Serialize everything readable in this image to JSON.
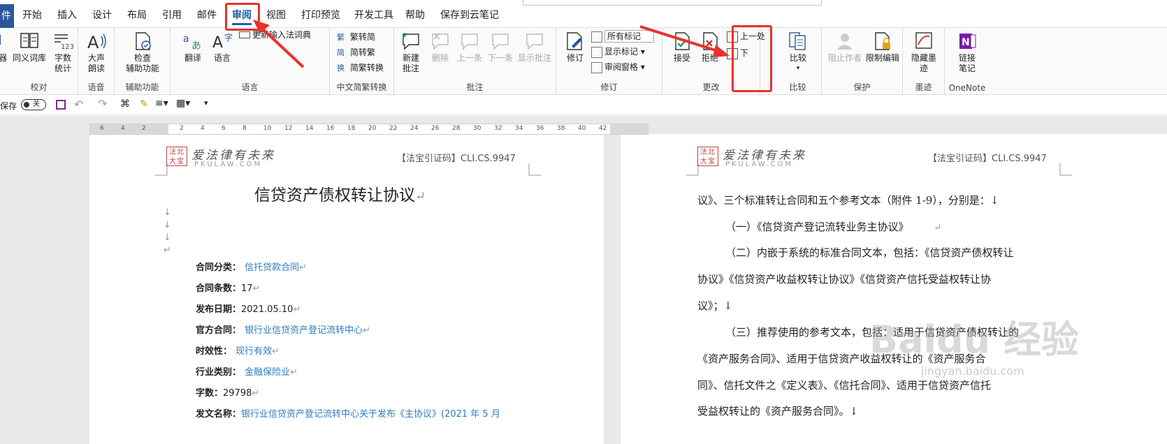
{
  "tabs": {
    "file": "件",
    "items": [
      "开始",
      "插入",
      "设计",
      "布局",
      "引用",
      "邮件",
      "审阅",
      "视图",
      "打印预览",
      "开发工具",
      "帮助",
      "保存到云笔记"
    ],
    "active": "审阅"
  },
  "ribbon": {
    "proofing": {
      "group_label": "校对",
      "b0": "器",
      "b1": "同义词库",
      "b2a": "字数",
      "b2b": "统计"
    },
    "speech": {
      "group_label": "语音",
      "b1a": "大声",
      "b1b": "朗读"
    },
    "accessibility": {
      "group_label": "辅助功能",
      "b1a": "检查",
      "b1b": "辅助功能"
    },
    "language": {
      "group_label": "语言",
      "translate": "翻译",
      "language": "语言",
      "update_ime": "更新输入法词典"
    },
    "chinese": {
      "group_label": "中文简繁转换",
      "t2s": "繁转简",
      "s2t": "简转繁",
      "convert": "简繁转换"
    },
    "comments": {
      "group_label": "批注",
      "new_a": "新建",
      "new_b": "批注",
      "delete": "删除",
      "prev": "上一条",
      "next": "下一条",
      "show": "显示批注"
    },
    "tracking": {
      "group_label": "修订",
      "track": "修订",
      "markup_select": "所有标记",
      "show_markup": "显示标记",
      "review_pane": "审阅窗格"
    },
    "changes": {
      "group_label": "更改",
      "accept": "接受",
      "reject": "拒绝",
      "prev": "上一处",
      "next": "下"
    },
    "compare": {
      "group_label": "比较",
      "compare": "比较"
    },
    "protect": {
      "group_label": "保护",
      "block_a": "阻止作者",
      "restrict": "限制编辑"
    },
    "ink": {
      "group_label": "墨迹",
      "hide_a": "隐藏墨",
      "hide_b": "迹"
    },
    "onenote": {
      "group_label": "OneNote",
      "link_a": "链接",
      "link_b": "笔记"
    }
  },
  "qat": {
    "autosave_label": "保存",
    "toggle": "关"
  },
  "ruler": {
    "ticks": [
      "6",
      "4",
      "2",
      "2",
      "4",
      "6",
      "8",
      "10",
      "12",
      "14",
      "16",
      "18",
      "20",
      "22",
      "24",
      "26",
      "28",
      "30",
      "32",
      "34",
      "36",
      "38",
      "40",
      "42"
    ]
  },
  "page_left": {
    "logo_seal": "法北大宝",
    "logo_main": "爱法律有未来",
    "logo_sub": "PKULAW.COM",
    "citation": "【法宝引证码】CLI.CS.9947",
    "title": "信贷资产债权转让协议",
    "fields": [
      {
        "label": "合同分类：",
        "value": "信托贷款合同",
        "link": true
      },
      {
        "label": "合同条数：",
        "value": "17",
        "link": false
      },
      {
        "label": "发布日期：",
        "value": "2021.05.10",
        "link": false
      },
      {
        "label": "官方合同：",
        "value": "银行业信贷资产登记流转中心",
        "link": true
      },
      {
        "label": "时效性：",
        "value": "现行有效",
        "link": true
      },
      {
        "label": "行业类别：",
        "value": "金融保险业",
        "link": true
      },
      {
        "label": "字数：",
        "value": "29798",
        "link": false
      },
      {
        "label": "发文名称：",
        "value": "银行业信贷资产登记流转中心关于发布《主协议》(2021 年 5 月",
        "link": true
      }
    ]
  },
  "page_right": {
    "logo_seal": "法北大宝",
    "logo_main": "爱法律有未来",
    "logo_sub": "PKULAW.COM",
    "citation": "【法宝引证码】CLI.CS.9947",
    "lines": [
      "议》、三个标准转让合同和五个参考文本（附件 1-9），分别是：↓",
      "（一）《信贷资产登记流转业务主协议》",
      "（二）内嵌于系统的标准合同文本，包括：《信贷资产债权转让",
      "协议》《信贷资产收益权转让协议》《信贷资产信托受益权转让协",
      "议》；↓",
      "（三）推荐使用的参考文本，包括：适用于信贷资产债权转让的",
      "《资产服务合同》、适用于信贷资产收益权转让的《资产服务合",
      "同》、信托文件之《定义表》、《信托合同》、适用于信贷资产信托",
      "受益权转让的《资产服务合同》。↓"
    ]
  },
  "watermark": {
    "main": "Baidu 经验",
    "sub": "jingyan.baidu.com"
  },
  "colors": {
    "accent": "#2b579a",
    "callout": "#e8322b",
    "link": "#2e7bbf"
  }
}
